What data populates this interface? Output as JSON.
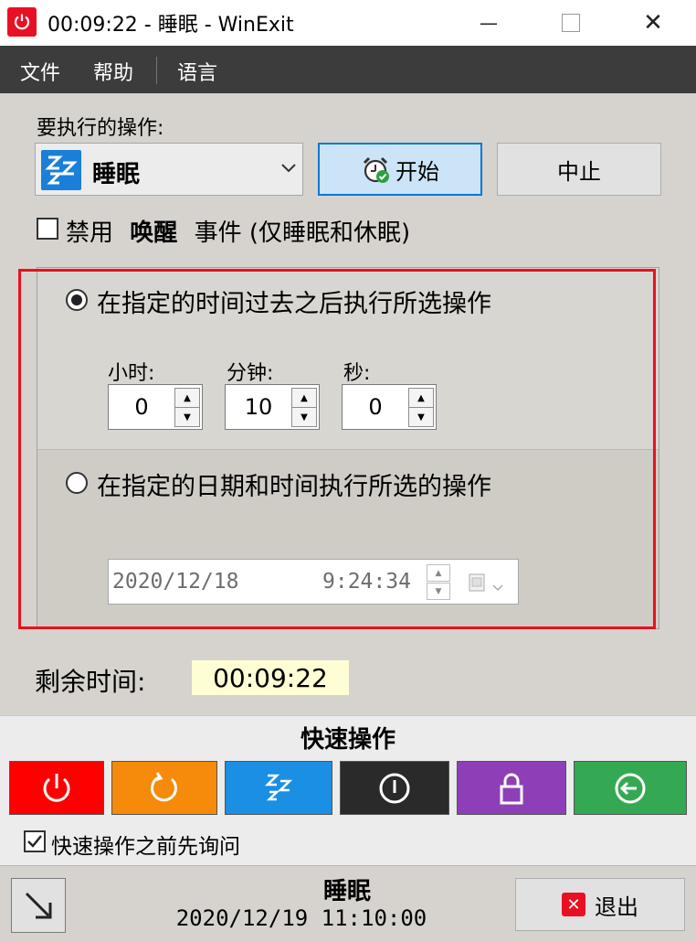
{
  "window": {
    "title": "00:09:22 - 睡眠 - WinExit",
    "minimize_symbol": "—",
    "close_symbol": "✕"
  },
  "menu": {
    "items": [
      "文件",
      "帮助",
      "语言"
    ]
  },
  "action": {
    "label": "要执行的操作:",
    "selected": "睡眠",
    "start_label": "开始",
    "stop_label": "中止"
  },
  "wake": {
    "prefix": "禁用",
    "bold": "唤醒",
    "suffix": "事件 (仅睡眠和休眠)",
    "checked": false
  },
  "mode_after": {
    "label": "在指定的时间过去之后执行所选操作",
    "selected": true,
    "hours_label": "小时:",
    "minutes_label": "分钟:",
    "seconds_label": "秒:",
    "hours": "0",
    "minutes": "10",
    "seconds": "0"
  },
  "mode_at": {
    "label": "在指定的日期和时间执行所选的操作",
    "selected": false,
    "date": "2020/12/18",
    "time": "9:24:34"
  },
  "remaining": {
    "label": "剩余时间:",
    "value": "00:09:22"
  },
  "quick": {
    "title": "快速操作",
    "buttons": [
      {
        "name": "shutdown",
        "icon": "power-icon",
        "color": "#ff0000"
      },
      {
        "name": "restart",
        "icon": "restart-icon",
        "color": "#f58a0b"
      },
      {
        "name": "sleep",
        "icon": "sleep-icon",
        "color": "#1a8fe3"
      },
      {
        "name": "hibernate",
        "icon": "hibernate-icon",
        "color": "#2a2a2a"
      },
      {
        "name": "lock",
        "icon": "lock-icon",
        "color": "#8e3fb8"
      },
      {
        "name": "logoff",
        "icon": "logoff-icon",
        "color": "#35a853"
      }
    ],
    "confirm_label": "快速操作之前先询问",
    "confirm_checked": true
  },
  "footer": {
    "action": "睡眠",
    "datetime": "2020/12/19 11:10:00",
    "exit_label": "退出"
  }
}
